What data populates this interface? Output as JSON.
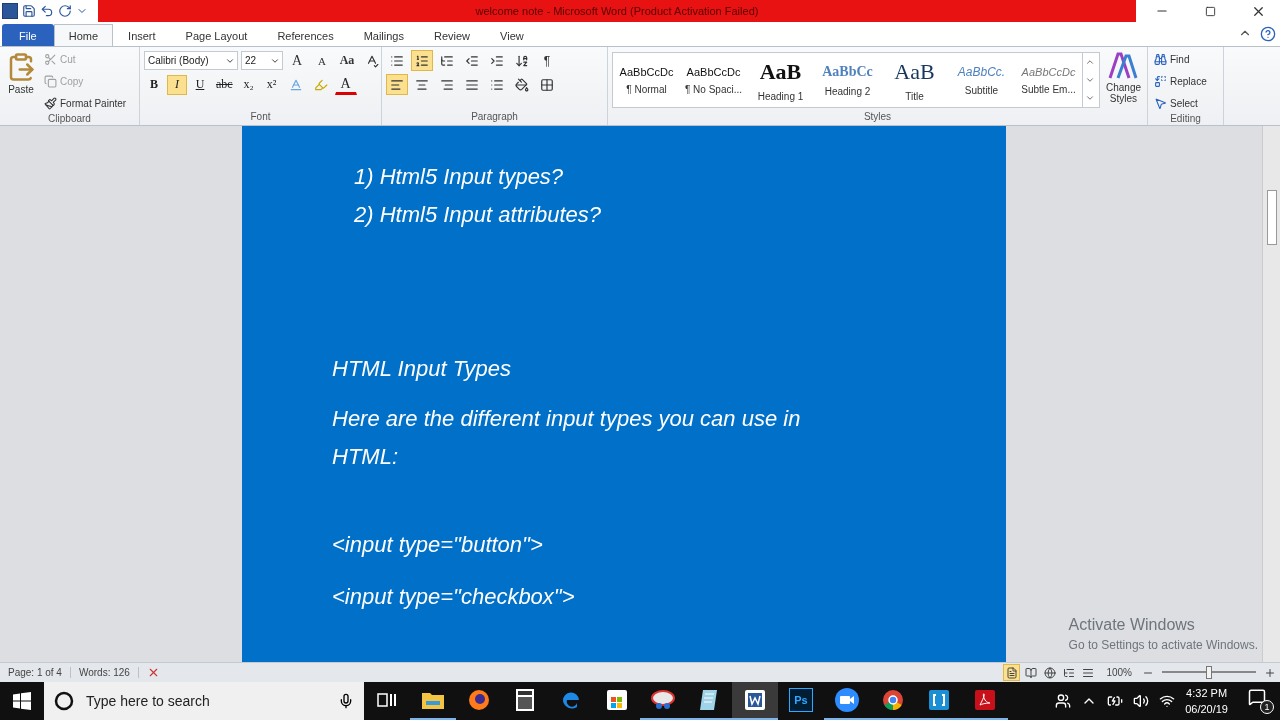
{
  "window": {
    "title": "welcome note  -  Microsoft Word (Product Activation Failed)"
  },
  "tabs": [
    {
      "label": "File",
      "kind": "file",
      "selected": false
    },
    {
      "label": "Home",
      "kind": "tab",
      "selected": true
    },
    {
      "label": "Insert",
      "kind": "tab",
      "selected": false
    },
    {
      "label": "Page Layout",
      "kind": "tab",
      "selected": false
    },
    {
      "label": "References",
      "kind": "tab",
      "selected": false
    },
    {
      "label": "Mailings",
      "kind": "tab",
      "selected": false
    },
    {
      "label": "Review",
      "kind": "tab",
      "selected": false
    },
    {
      "label": "View",
      "kind": "tab",
      "selected": false
    }
  ],
  "ribbon": {
    "clipboard": {
      "label": "Clipboard",
      "paste": "Paste",
      "actions": [
        {
          "label": "Cut",
          "kind": "cut",
          "disabled": true
        },
        {
          "label": "Copy",
          "kind": "copy",
          "disabled": true
        },
        {
          "label": "Format Painter",
          "kind": "painter",
          "disabled": false
        }
      ]
    },
    "font": {
      "label": "Font",
      "font_name": "Calibri (Body)",
      "font_size": "22",
      "grow": "A",
      "shrink": "A",
      "case": "Aa",
      "formats": [
        {
          "label": "B",
          "kind": "bold",
          "selected": false
        },
        {
          "label": "I",
          "kind": "italic",
          "selected": true
        },
        {
          "label": "U",
          "kind": "underline",
          "selected": false
        },
        {
          "label": "abc",
          "kind": "strike",
          "selected": false
        },
        {
          "label": "x₂",
          "kind": "sub",
          "selected": false
        },
        {
          "label": "x²",
          "kind": "sup",
          "selected": false
        }
      ],
      "text_color_letter": "A"
    },
    "paragraph": {
      "label": "Paragraph",
      "numbering_selected": true,
      "alignments": [
        {
          "kind": "left",
          "selected": true
        },
        {
          "kind": "center",
          "selected": false
        },
        {
          "kind": "right",
          "selected": false
        },
        {
          "kind": "justify",
          "selected": false
        }
      ],
      "pilcrow": "¶"
    },
    "styles": {
      "label": "Styles",
      "items": [
        {
          "preview": "AaBbCcDc",
          "name": "¶ Normal",
          "kind": "normal"
        },
        {
          "preview": "AaBbCcDc",
          "name": "¶ No Spaci...",
          "kind": "normal"
        },
        {
          "preview": "AaB",
          "name": "Heading 1",
          "kind": "heading1"
        },
        {
          "preview": "AaBbCc",
          "name": "Heading 2",
          "kind": "heading2"
        },
        {
          "preview": "AaB",
          "name": "Title",
          "kind": "title"
        },
        {
          "preview": "AaBbCc.",
          "name": "Subtitle",
          "kind": "subtitle"
        },
        {
          "preview": "AaBbCcDc",
          "name": "Subtle Em...",
          "kind": "emphasis"
        }
      ],
      "change_styles": [
        "Change",
        "Styles"
      ]
    },
    "editing": {
      "label": "Editing",
      "actions": [
        {
          "label": "Find",
          "kind": "find"
        },
        {
          "label": "Replace",
          "kind": "replace"
        },
        {
          "label": "Select",
          "kind": "select"
        }
      ]
    }
  },
  "document": {
    "lines": [
      {
        "text": "1) Html5 Input types?",
        "kind": "list"
      },
      {
        "text": "2) Html5 Input attributes?",
        "kind": "list"
      },
      {
        "text": "HTML Input Types",
        "kind": "heading"
      },
      {
        "text": "Here are the different input types you can use in HTML:",
        "kind": "para"
      },
      {
        "text": "<input type=\"button\">",
        "kind": "code"
      },
      {
        "text": "<input type=\"checkbox\">",
        "kind": "code"
      }
    ]
  },
  "activation": {
    "title": "Activate Windows",
    "subtitle": "Go to Settings to activate Windows."
  },
  "status_bar": {
    "page": "Page: 1 of 4",
    "words": "Words: 126",
    "zoom": "100%",
    "zoom_level": {
      "level": 0.5
    },
    "views": [
      {
        "kind": "print",
        "selected": true
      },
      {
        "kind": "reading",
        "selected": false
      },
      {
        "kind": "web",
        "selected": false
      },
      {
        "kind": "outline",
        "selected": false
      },
      {
        "kind": "draft",
        "selected": false
      }
    ]
  },
  "taskbar": {
    "search": {
      "placeholder": "Type here to search"
    },
    "apps": [
      {
        "kind": "taskview",
        "running": false,
        "active": false
      },
      {
        "kind": "explorer",
        "running": true,
        "active": false
      },
      {
        "kind": "firefox",
        "running": false,
        "active": false
      },
      {
        "kind": "calculator",
        "running": false,
        "active": false
      },
      {
        "kind": "edge",
        "running": false,
        "active": false
      },
      {
        "kind": "store",
        "running": false,
        "active": false
      },
      {
        "kind": "snip",
        "running": true,
        "active": false
      },
      {
        "kind": "notepad",
        "running": true,
        "active": false
      },
      {
        "kind": "word",
        "running": true,
        "active": true
      },
      {
        "kind": "photoshop",
        "running": false,
        "active": false,
        "label": "Ps"
      },
      {
        "kind": "zoom",
        "running": true,
        "active": false
      },
      {
        "kind": "chrome",
        "running": true,
        "active": false
      },
      {
        "kind": "brackets",
        "running": true,
        "active": false
      },
      {
        "kind": "acrobat",
        "running": true,
        "active": false
      }
    ],
    "time": "4:32 PM",
    "date": "06/20/19",
    "notifications": "1"
  }
}
